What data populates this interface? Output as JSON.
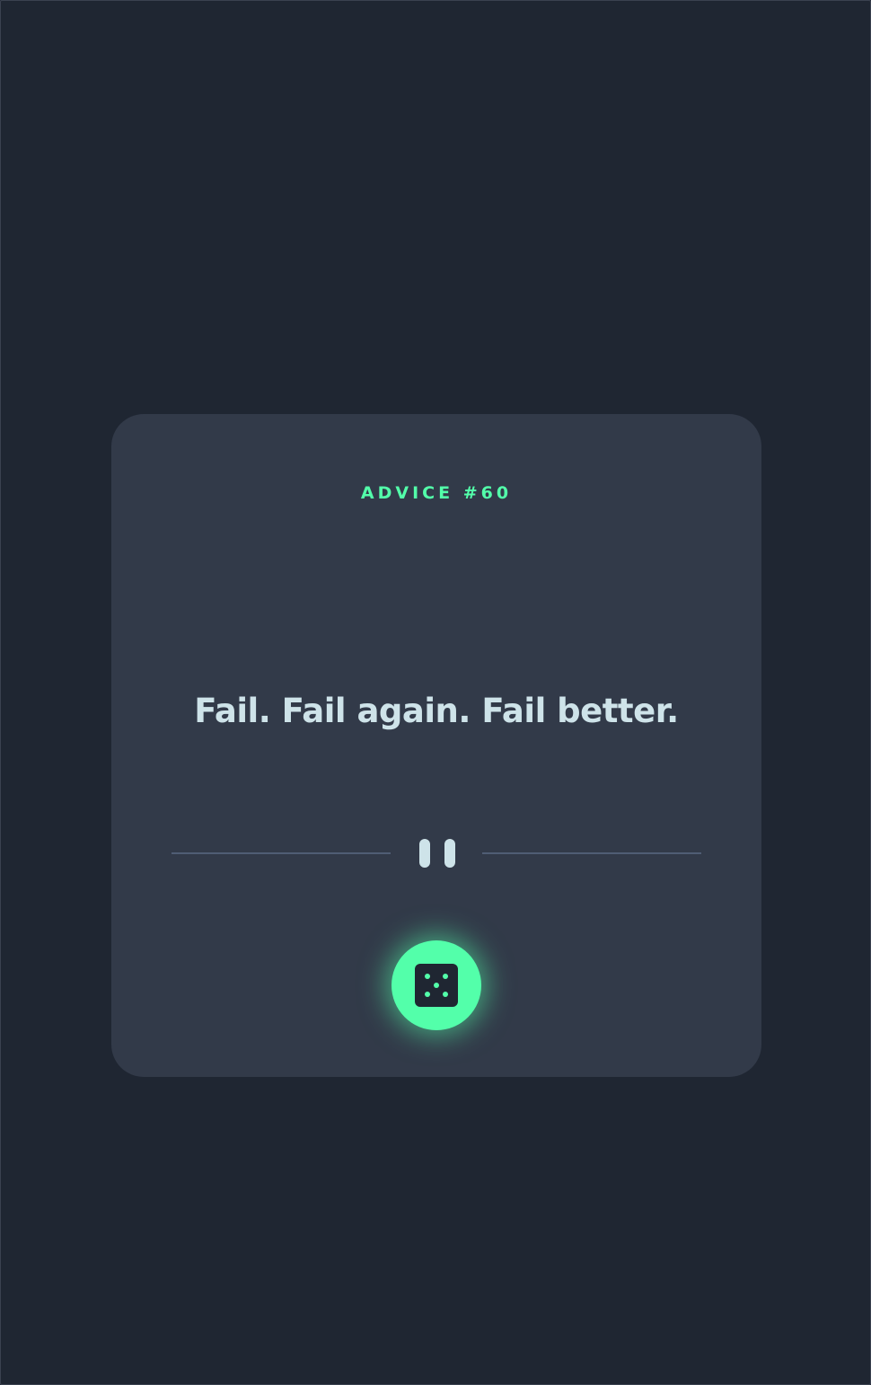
{
  "advice": {
    "id_label": "ADVICE #60",
    "text": "Fail. Fail again. Fail better."
  },
  "divider": {
    "icon": "pause-icon"
  },
  "dice_button": {
    "icon": "dice-icon"
  },
  "colors": {
    "background": "#1f2632",
    "card": "#323a49",
    "accent": "#53ffaa",
    "text": "#cee3e9",
    "divider": "#4f5d74"
  }
}
